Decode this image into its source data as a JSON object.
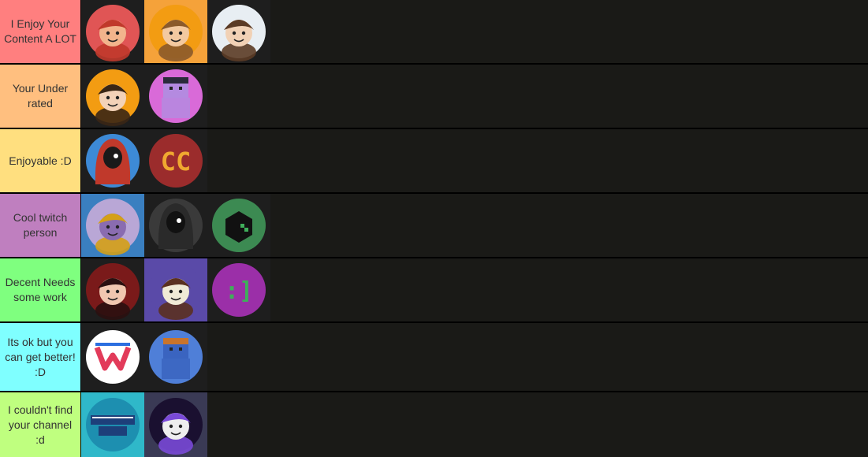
{
  "tiers": [
    {
      "label": "I Enjoy Your Content A LOT",
      "color": "#ff7f7f",
      "items": [
        {
          "name": "avatar-red-hair-fedora",
          "icon": "cartoon-avatar-icon",
          "bg": "#1e1e1e",
          "circle": "#e05555",
          "face": "#f2b48c",
          "hair": "#c0392b"
        },
        {
          "name": "avatar-orange-shirt-boy",
          "icon": "cartoon-avatar-icon",
          "bg": "#f5a23a",
          "circle": "#f39c12",
          "face": "#f3c9a0",
          "hair": "#8b5a2b"
        },
        {
          "name": "avatar-pixel-shades-boy",
          "icon": "cartoon-avatar-icon",
          "bg": "#1e1e1e",
          "circle": "#e8eef3",
          "face": "#f1d1b5",
          "hair": "#5b3b25"
        }
      ]
    },
    {
      "label": "Your Under rated",
      "color": "#ffbf7f",
      "items": [
        {
          "name": "avatar-curly-hair-boy",
          "icon": "cartoon-avatar-icon",
          "bg": "#1e1e1e",
          "circle": "#f39c12",
          "face": "#f3d2b8",
          "hair": "#3a2615"
        },
        {
          "name": "avatar-purple-minecraft-skin",
          "icon": "minecraft-skin-icon",
          "bg": "#1e1e1e",
          "circle": "#d96ad8",
          "face": "#b48ae0",
          "hair": "#2a2a3a"
        }
      ]
    },
    {
      "label": "Enjoyable :D",
      "color": "#ffdf7f",
      "items": [
        {
          "name": "avatar-red-hooded-figure",
          "icon": "hooded-figure-icon",
          "bg": "#1e1e1e",
          "circle": "#3d8ad6",
          "face": "#1a1a1a",
          "hair": "#c0392b"
        },
        {
          "name": "avatar-cc-logo",
          "icon": "cc-logo-icon",
          "bg": "#1e1e1e",
          "circle": "#9b2c2c",
          "face": "#f0a830",
          "hair": "#9b2c2c"
        }
      ]
    },
    {
      "label": "Cool twitch person",
      "color": "#bf7fbf",
      "items": [
        {
          "name": "avatar-thanos-gauntlet",
          "icon": "gauntlet-character-icon",
          "bg": "#3a7fc0",
          "circle": "#b9a7d6",
          "face": "#8a6cb0",
          "hair": "#d4a017"
        },
        {
          "name": "avatar-masked-hooded-figure",
          "icon": "hooded-figure-icon",
          "bg": "#1e1e1e",
          "circle": "#3a3a3a",
          "face": "#111111",
          "hair": "#2a2a2a"
        },
        {
          "name": "avatar-green-cube-logo",
          "icon": "cube-logo-icon",
          "bg": "#1e1e1e",
          "circle": "#3c8a52",
          "face": "#111111",
          "hair": "#3c8a52"
        }
      ]
    },
    {
      "label": "Decent Needs some work",
      "color": "#7fff7f",
      "items": [
        {
          "name": "avatar-dark-red-anime-character",
          "icon": "cartoon-avatar-icon",
          "bg": "#1e1e1e",
          "circle": "#7a1a1a",
          "face": "#f0c7b0",
          "hair": "#2a1010"
        },
        {
          "name": "avatar-smiling-purple-bg",
          "icon": "cartoon-avatar-icon",
          "bg": "#5a4aa8",
          "circle": "#5a4aa8",
          "face": "#f0ead6",
          "hair": "#5a3020"
        },
        {
          "name": "avatar-purple-emoticon",
          "icon": "emoticon-logo-icon",
          "bg": "#1e1e1e",
          "circle": "#9b2fa8",
          "face": "#3fae5a",
          "hair": "#9b2fa8"
        }
      ]
    },
    {
      "label": "Its ok but you can get better!\n:D",
      "color": "#7fffff",
      "items": [
        {
          "name": "avatar-w-logo",
          "icon": "w-logo-icon",
          "bg": "#1e1e1e",
          "circle": "#ffffff",
          "face": "#e23b5a",
          "hair": "#2b6fe0"
        },
        {
          "name": "avatar-blue-minecraft-creature",
          "icon": "minecraft-creature-icon",
          "bg": "#1e1e1e",
          "circle": "#4f7fd8",
          "face": "#3a64c0",
          "hair": "#c9742b"
        }
      ]
    },
    {
      "label": "I couldn't find your channel :d",
      "color": "#bfff7f",
      "items": [
        {
          "name": "avatar-evolve-smp-logo",
          "icon": "server-logo-icon",
          "bg": "#2fb8c9",
          "circle": "#1d8fb0",
          "face": "#ffffff",
          "hair": "#1d3f7a"
        },
        {
          "name": "avatar-space-ninja",
          "icon": "ninja-character-icon",
          "bg": "#3a3a55",
          "circle": "#1a1030",
          "face": "#eeeeee",
          "hair": "#7a4ad8"
        }
      ]
    }
  ]
}
